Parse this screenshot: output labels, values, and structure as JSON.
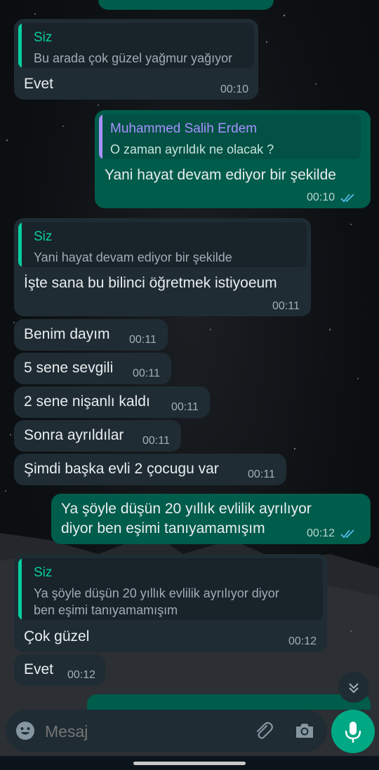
{
  "messages": [
    {
      "quote_name": "Siz",
      "quote_text": "Bu arada çok güzel yağmur yağıyor",
      "text": "Evet",
      "time": "00:10"
    },
    {
      "quote_name": "Muhammed Salih Erdem",
      "quote_text": "O zaman ayrıldık ne olacak ?",
      "text": "Yani hayat devam ediyor bir şekilde",
      "time": "00:10"
    },
    {
      "quote_name": "Siz",
      "quote_text": "Yani hayat devam ediyor bir şekilde",
      "text": "İşte sana bu bilinci öğretmek istiyoeum",
      "time": "00:11"
    },
    {
      "text": "Benim dayım",
      "time": "00:11"
    },
    {
      "text": "5 sene sevgili",
      "time": "00:11"
    },
    {
      "text": "2 sene nişanlı kaldı",
      "time": "00:11"
    },
    {
      "text": "Sonra ayrıldılar",
      "time": "00:11"
    },
    {
      "text": "Şimdi başka evli 2 çocugu var",
      "time": "00:11"
    },
    {
      "text_line1": "Ya şöyle düşün 20 yıllık evlilik ayrılıyor",
      "text_line2": "diyor ben eşimi tanıyamamışım",
      "time": "00:12"
    },
    {
      "quote_name": "Siz",
      "quote_line1": "Ya şöyle düşün 20 yıllık evlilik ayrılıyor diyor",
      "quote_line2": "ben eşimi tanıyamamışım",
      "text": "Çok güzel",
      "time": "00:12"
    },
    {
      "text": "Evet",
      "time": "00:12"
    }
  ],
  "composer": {
    "placeholder": "Mesaj"
  },
  "icons": {
    "emoji": "emoji-icon",
    "attach": "paperclip-icon",
    "camera": "camera-icon",
    "mic": "microphone-icon",
    "scroll": "chevron-double-down-icon",
    "read": "double-check-icon"
  },
  "colors": {
    "incoming": "#1f2c34",
    "outgoing": "#005c4b",
    "accent": "#00a884",
    "quote_self": "#06cf9c",
    "quote_other": "#a791ff",
    "read_tick": "#53bdeb"
  }
}
